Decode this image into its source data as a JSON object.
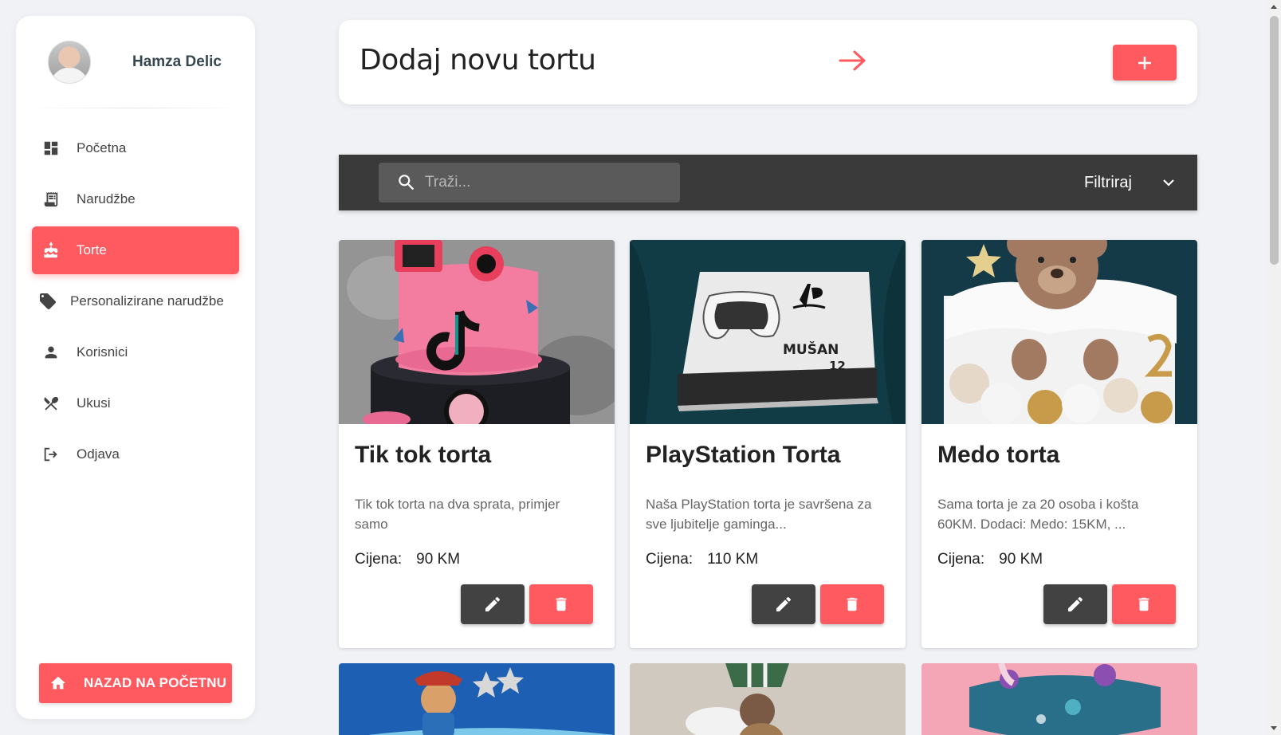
{
  "user": {
    "name": "Hamza Delic"
  },
  "nav": {
    "items": [
      {
        "label": "Početna",
        "icon": "dashboard-icon"
      },
      {
        "label": "Narudžbe",
        "icon": "receipt-icon"
      },
      {
        "label": "Torte",
        "icon": "cake-icon",
        "active": true
      },
      {
        "label": "Personalizirane narudžbe",
        "icon": "tag-icon"
      },
      {
        "label": "Korisnici",
        "icon": "person-icon"
      },
      {
        "label": "Ukusi",
        "icon": "utensils-icon"
      },
      {
        "label": "Odjava",
        "icon": "logout-icon"
      }
    ],
    "home_button": "NAZAD NA POČETNU"
  },
  "add_card": {
    "title": "Dodaj novu tortu"
  },
  "search": {
    "placeholder": "Traži...",
    "value": ""
  },
  "filter": {
    "label": "Filtriraj"
  },
  "cakes": [
    {
      "title": "Tik tok torta",
      "description": "Tik tok torta na dva sprata, primjer samo",
      "price_label": "Cijena:",
      "price": "90 KM"
    },
    {
      "title": "PlayStation Torta",
      "description": "Naša PlayStation torta je savršena za sve ljubitelje gaminga...",
      "price_label": "Cijena:",
      "price": "110 KM"
    },
    {
      "title": "Medo torta",
      "description": "Sama torta je za 20 osoba i košta 60KM. Dodaci: Medo: 15KM, ...",
      "price_label": "Cijena:",
      "price": "90 KM"
    }
  ],
  "ps_cake_text": {
    "name": "MUŠAN",
    "age": "12"
  },
  "colors": {
    "accent": "#ff5a5f",
    "dark": "#3a3a3a",
    "background": "#f0f2f5"
  }
}
